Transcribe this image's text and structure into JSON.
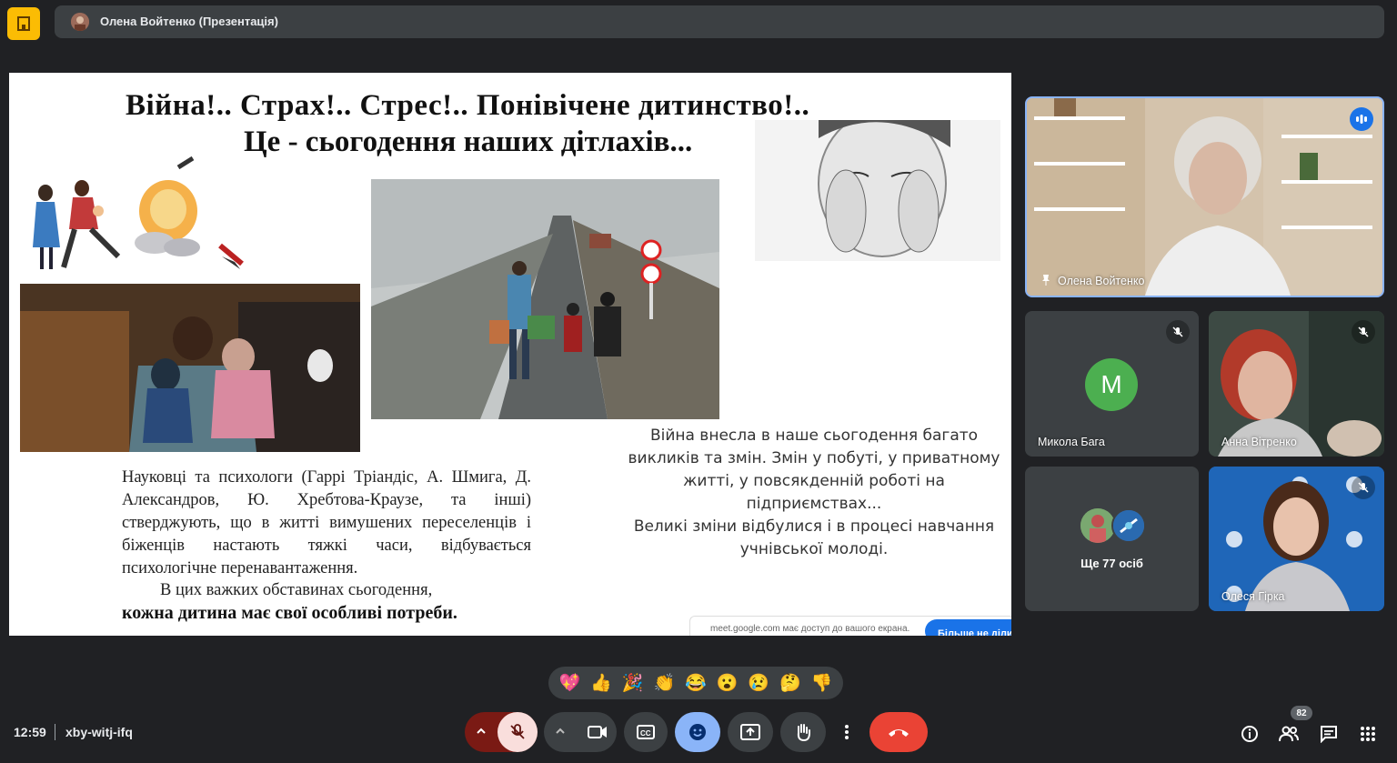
{
  "header": {
    "presenter_title": "Олена Войтенко (Презентація)"
  },
  "slide": {
    "title_line1": "Війна!.. Страх!.. Стрес!.. Понівічене дитинство!..",
    "title_line2": "Це - сьогодення наших дітлахів...",
    "left_paragraph": "Науковці та психологи (Гаррі Тріандіс, А. Шмига, Д. Александров, Ю. Хребтова-Краузе, та інші) стверджують, що в житті вимушених переселенців і біженців настають тяжкі часи, відбувається психологічне перенавантаження.",
    "left_center_line": "В цих важких обставинах сьогодення,",
    "left_bold_line": "кожна дитина має свої особливі потреби.",
    "right_paragraph_1": "Війна внесла в наше сьогодення багато викликів та змін. Змін у побуті, у приватному житті, у повсякденній роботі на підприємствах...",
    "right_paragraph_2": "Великі зміни відбулися і в процесі навчання учнівської молоді."
  },
  "share_notice": {
    "text": "meet.google.com має доступ до вашого екрана.",
    "button": "Більше не діли"
  },
  "participants": {
    "main": {
      "name": "Олена Войтенко"
    },
    "tile_1": {
      "name": "Микола Бага",
      "initial": "М",
      "avatar_color": "#4caf50"
    },
    "tile_2": {
      "name": "Анна Вітренко"
    },
    "tile_3": {
      "name": "Ще 77 осіб"
    },
    "tile_4": {
      "name": "Олеся Гірка"
    }
  },
  "reactions": [
    "💖",
    "👍",
    "🎉",
    "👏",
    "😂",
    "😮",
    "😢",
    "🤔",
    "👎"
  ],
  "footer": {
    "time": "12:59",
    "meeting_code": "xby-witj-ifq",
    "participant_count": "82"
  },
  "colors": {
    "background": "#202124",
    "end_call": "#ea4335",
    "active_button": "#8ab4f8",
    "home_button": "#fbbc04"
  }
}
